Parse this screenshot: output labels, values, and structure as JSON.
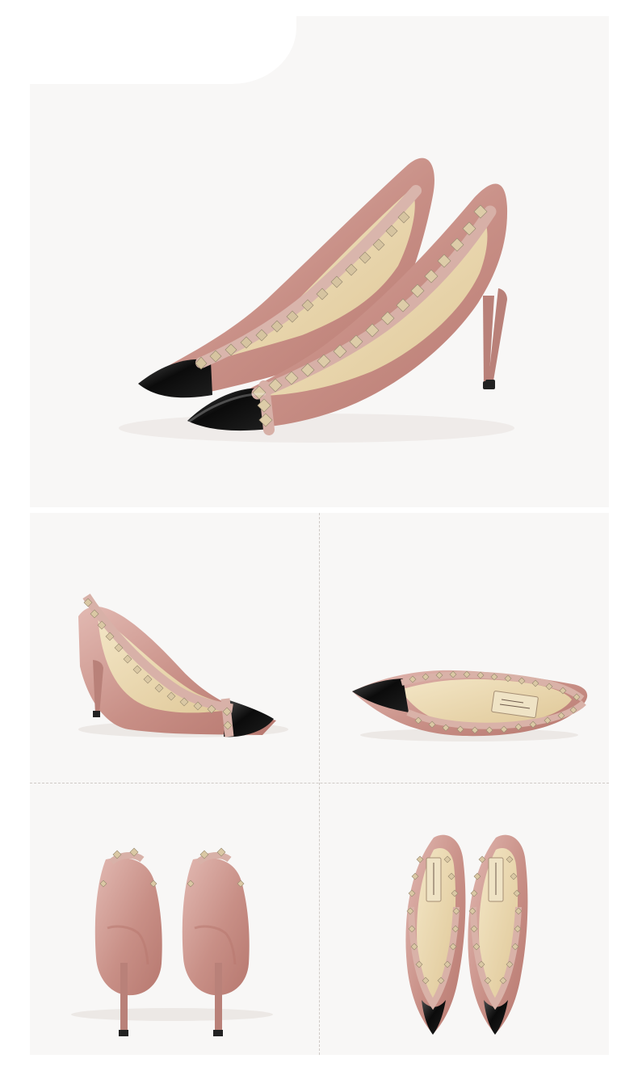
{
  "product_views": [
    {
      "view": "main-pair"
    },
    {
      "view": "side-profile"
    },
    {
      "view": "top-side"
    },
    {
      "view": "back-pair"
    },
    {
      "view": "top-pair"
    }
  ],
  "colors": {
    "background": "#ffffff",
    "panel": "#f8f7f6",
    "nude": "#d2a59e",
    "nude_dark": "#b98179",
    "black_tip": "#111111",
    "stud": "#d8c8a7",
    "insole": "#ead8ae",
    "divider": "#cfcac6"
  },
  "icons": [
    "shoe-image"
  ]
}
